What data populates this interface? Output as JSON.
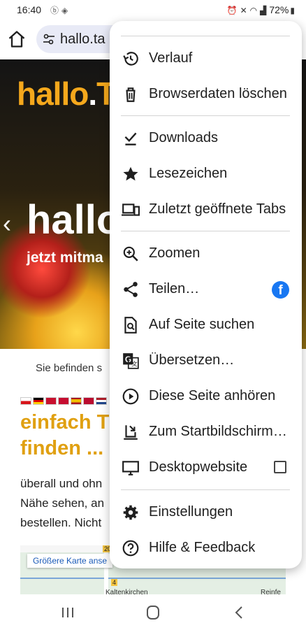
{
  "status_bar": {
    "time": "16:40",
    "battery": "72%",
    "left_icons": [
      "notification-icon",
      "shield-icon"
    ],
    "right_icons": [
      "alarm-icon",
      "mute-icon",
      "wifi-icon",
      "signal-icon",
      "battery-icon"
    ]
  },
  "toolbar": {
    "url": "hallo.ta"
  },
  "page": {
    "logo_main": "hallo",
    "logo_dot": ".",
    "logo_rest": "TA",
    "hero_headline": "hallo",
    "hero_sub": "jetzt mitma",
    "breadcrumb": "Sie befinden s",
    "heading_line1": "einfach T",
    "heading_line2": "finden ...",
    "para_line1": "überall und ohn",
    "para_line2": "Nähe sehen, an",
    "para_line3": "bestellen. Nicht",
    "map_button": "Größere Karte anse",
    "map_marker1": "20",
    "map_marker2": "4",
    "map_place1": "Kaltenkirchen",
    "map_place2": "Reinfe"
  },
  "menu": {
    "items": [
      {
        "label": "Verlauf",
        "icon": "history-icon"
      },
      {
        "label": "Browserdaten löschen",
        "icon": "trash-icon"
      },
      {
        "label": "Downloads",
        "icon": "download-icon"
      },
      {
        "label": "Lesezeichen",
        "icon": "star-icon"
      },
      {
        "label": "Zuletzt geöffnete Tabs",
        "icon": "recent-tabs-icon"
      },
      {
        "label": "Zoomen",
        "icon": "zoom-in-icon"
      },
      {
        "label": "Teilen…",
        "icon": "share-icon"
      },
      {
        "label": "Auf Seite suchen",
        "icon": "find-in-page-icon"
      },
      {
        "label": "Übersetzen…",
        "icon": "translate-icon"
      },
      {
        "label": "Diese Seite anhören",
        "icon": "play-circle-icon"
      },
      {
        "label": "Zum Startbildschirm hinzufügen",
        "icon": "add-to-home-icon"
      },
      {
        "label": "Desktopwebsite",
        "icon": "desktop-icon"
      },
      {
        "label": "Einstellungen",
        "icon": "gear-icon"
      },
      {
        "label": "Hilfe & Feedback",
        "icon": "help-icon"
      }
    ],
    "share_app_icon": "facebook-icon",
    "desktop_checked": false
  },
  "colors": {
    "accent": "#f5a81c",
    "heading": "#e0a011",
    "omnibox": "#e8eaf6",
    "facebook": "#1877f2"
  }
}
